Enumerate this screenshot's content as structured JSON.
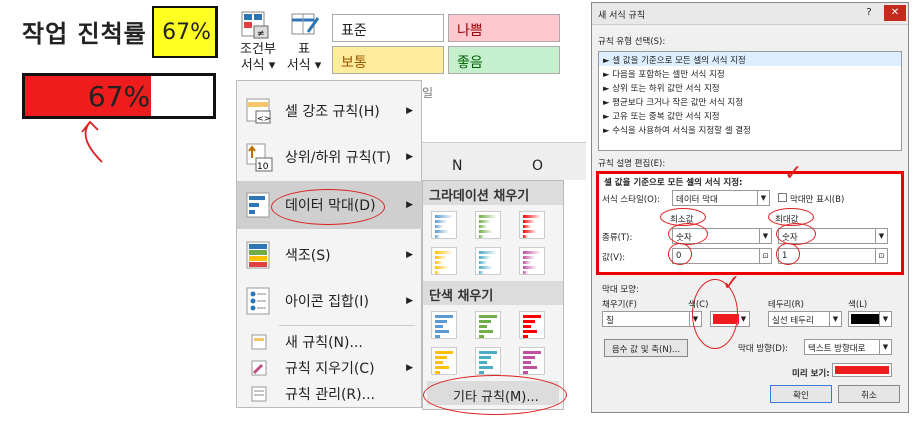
{
  "sheet": {
    "title": "작업 진척률",
    "percent": "67%",
    "bar_label": "67%",
    "bar_progress": 0.67,
    "bar_color": "#ee1c1c"
  },
  "ribbon": {
    "cond_format_line1": "조건부",
    "cond_format_line2": "서식",
    "table_line1": "표",
    "table_line2": "서식",
    "styles": [
      {
        "label": "표준",
        "bg": "#ffffff"
      },
      {
        "label": "나쁨",
        "bg": "#ffc7ce"
      },
      {
        "label": "보통",
        "bg": "#ffeb9c"
      },
      {
        "label": "좋음",
        "bg": "#c6efce"
      }
    ],
    "partial_label": "일",
    "col_n": "N",
    "col_o": "O"
  },
  "menu": {
    "highlight_rules": "셀 강조 규칙(H)",
    "top_bottom_rules": "상위/하위 규칙(T)",
    "data_bars": "데이터 막대(D)",
    "color_scales": "색조(S)",
    "icon_sets": "아이콘 집합(I)",
    "new_rule": "새 규칙(N)...",
    "clear_rules": "규칙 지우기(C)",
    "manage_rules": "규칙 관리(R)..."
  },
  "submenu": {
    "gradient_header": "그라데이션 채우기",
    "solid_header": "단색 채우기",
    "more_rules": "기타 규칙(M)...",
    "colors": [
      "#5b9bd5",
      "#70ad47",
      "#ff0000",
      "#ffc000",
      "#4bacc6",
      "#c050a0"
    ]
  },
  "dialog": {
    "title": "새 서식 규칙",
    "help": "?",
    "close": "✕",
    "rule_type_label": "규칙 유형 선택(S):",
    "rule_types": [
      "► 셀 값을 기준으로 모든 셀의 서식 지정",
      "► 다음을 포함하는 셀만 서식 지정",
      "► 상위 또는 하위 값만 서식 지정",
      "► 평균보다 크거나 작은 값만 서식 지정",
      "► 고유 또는 중복 값만 서식 지정",
      "► 수식을 사용하여 서식을 지정할 셀 결정"
    ],
    "edit_label": "규칙 설명 편집(E):",
    "edit_heading": "셀 값을 기준으로 모든 셀의 서식 지정:",
    "format_style_label": "서식 스타일(O):",
    "format_style_value": "데이터 막대",
    "bar_only": "막대만 표시(B)",
    "min_label": "최소값",
    "max_label": "최대값",
    "type_label": "종류(T):",
    "min_type": "숫자",
    "max_type": "숫자",
    "value_label": "값(V):",
    "min_value": "0",
    "max_value": "1",
    "bar_appearance": "막대 모양:",
    "fill_label": "채우기(F)",
    "fill_value": "칠",
    "color_label": "색(C)",
    "fill_color": "#ee1c1c",
    "border_label": "테두리(R)",
    "border_value": "실선 테두리",
    "border_color_label": "색(L)",
    "border_color": "#000000",
    "neg_axis_btn": "음수 값 및 축(N)...",
    "bar_direction_label": "막대 방향(D):",
    "bar_direction_value": "텍스트 방향대로",
    "preview_label": "미리 보기:",
    "ok": "확인",
    "cancel": "취소"
  }
}
